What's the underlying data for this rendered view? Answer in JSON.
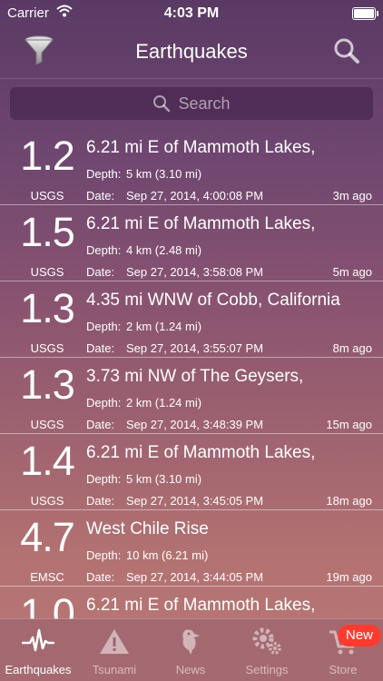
{
  "status_bar": {
    "carrier": "Carrier",
    "time": "4:03 PM"
  },
  "nav": {
    "title": "Earthquakes"
  },
  "search": {
    "placeholder": "Search"
  },
  "labels": {
    "depth": "Depth:",
    "date": "Date:"
  },
  "quakes": [
    {
      "magnitude": "1.2",
      "source": "USGS",
      "place": "6.21 mi E of Mammoth Lakes,",
      "depth": "5 km (3.10 mi)",
      "date": "Sep 27, 2014, 4:00:08 PM",
      "ago": "3m ago"
    },
    {
      "magnitude": "1.5",
      "source": "USGS",
      "place": "6.21 mi E of Mammoth Lakes,",
      "depth": "4 km (2.48 mi)",
      "date": "Sep 27, 2014, 3:58:08 PM",
      "ago": "5m ago"
    },
    {
      "magnitude": "1.3",
      "source": "USGS",
      "place": "4.35 mi WNW of Cobb, California",
      "depth": "2 km (1.24 mi)",
      "date": "Sep 27, 2014, 3:55:07 PM",
      "ago": "8m ago"
    },
    {
      "magnitude": "1.3",
      "source": "USGS",
      "place": "3.73 mi NW of The Geysers,",
      "depth": "2 km (1.24 mi)",
      "date": "Sep 27, 2014, 3:48:39 PM",
      "ago": "15m ago"
    },
    {
      "magnitude": "1.4",
      "source": "USGS",
      "place": "6.21 mi E of Mammoth Lakes,",
      "depth": "5 km (3.10 mi)",
      "date": "Sep 27, 2014, 3:45:05 PM",
      "ago": "18m ago"
    },
    {
      "magnitude": "4.7",
      "source": "EMSC",
      "place": "West Chile Rise",
      "depth": "10 km (6.21 mi)",
      "date": "Sep 27, 2014, 3:44:05 PM",
      "ago": "19m ago"
    },
    {
      "magnitude": "1.0",
      "source": "",
      "place": "6.21 mi E of Mammoth Lakes,",
      "depth": "",
      "date": "",
      "ago": ""
    }
  ],
  "tabs": [
    {
      "label": "Earthquakes",
      "icon": "seismograph-icon",
      "active": true
    },
    {
      "label": "Tsunami",
      "icon": "warning-icon",
      "active": false
    },
    {
      "label": "News",
      "icon": "bird-icon",
      "active": false
    },
    {
      "label": "Settings",
      "icon": "gears-icon",
      "active": false
    },
    {
      "label": "Store",
      "icon": "cart-icon",
      "active": false
    }
  ],
  "store_badge": "New"
}
